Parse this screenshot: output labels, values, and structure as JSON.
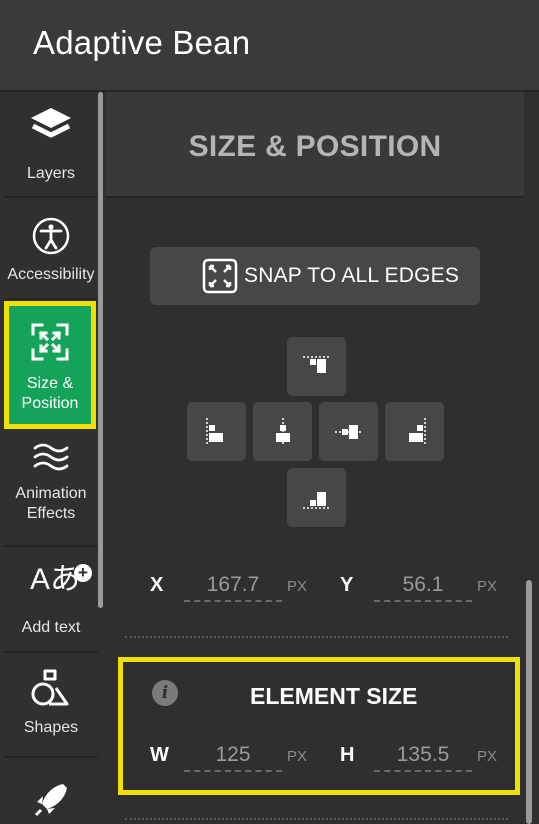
{
  "app": {
    "title": "Adaptive Bean"
  },
  "sidebar": {
    "items": [
      {
        "label": "Layers",
        "icon": "layers-icon"
      },
      {
        "label": "Accessibility",
        "icon": "accessibility-icon"
      },
      {
        "label": "Size &\nPosition",
        "label_line1": "Size &",
        "label_line2": "Position",
        "icon": "resize-arrows-icon",
        "active": true
      },
      {
        "label_line1": "Animation",
        "label_line2": "Effects",
        "icon": "waves-icon"
      },
      {
        "label": "Add text",
        "icon": "add-text-icon"
      },
      {
        "label": "Shapes",
        "icon": "shapes-icon"
      },
      {
        "label": "",
        "icon": "rocket-icon"
      }
    ],
    "active_color": "#15a35a",
    "highlight_color": "#f0e000"
  },
  "panel": {
    "title": "SIZE & POSITION",
    "snap_button": {
      "label": "SNAP TO ALL EDGES",
      "icon": "snap-edges-icon"
    },
    "align_buttons": [
      "align-top-icon",
      "align-left-icon",
      "align-center-horizontal-icon",
      "align-middle-vertical-icon",
      "align-right-icon",
      "align-bottom-icon"
    ],
    "position": {
      "x_label": "X",
      "x_value": "167.7",
      "x_unit": "PX",
      "y_label": "Y",
      "y_value": "56.1",
      "y_unit": "PX"
    },
    "element_size": {
      "title": "ELEMENT SIZE",
      "info_icon": "i",
      "w_label": "W",
      "w_value": "125",
      "w_unit": "PX",
      "h_label": "H",
      "h_value": "135.5",
      "h_unit": "PX"
    }
  }
}
